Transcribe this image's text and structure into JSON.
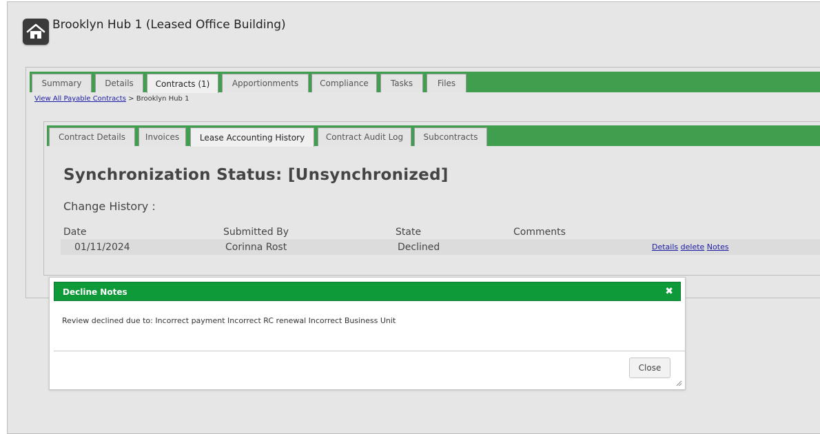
{
  "page": {
    "title": "Brooklyn Hub 1 (Leased Office Building)",
    "home_icon": "home-icon"
  },
  "main_tabs": [
    {
      "label": "Summary"
    },
    {
      "label": "Details"
    },
    {
      "label": "Contracts (1)",
      "active": true
    },
    {
      "label": "Apportionments"
    },
    {
      "label": "Compliance"
    },
    {
      "label": "Tasks"
    },
    {
      "label": "Files"
    }
  ],
  "breadcrumb": {
    "link": "View All Payable Contracts",
    "separator": ">",
    "current": "Brooklyn Hub 1"
  },
  "sub_tabs": [
    {
      "label": "Contract Details"
    },
    {
      "label": "Invoices"
    },
    {
      "label": "Lease Accounting History",
      "active": true
    },
    {
      "label": "Contract Audit Log"
    },
    {
      "label": "Subcontracts"
    }
  ],
  "content": {
    "sync_status": "Synchronization Status: [Unsynchronized]",
    "change_history": "Change History :",
    "columns": [
      "Date",
      "Submitted By",
      "State",
      "Comments"
    ],
    "rows": [
      {
        "date": "01/11/2024",
        "submitted_by": "Corinna Rost",
        "state": "Declined",
        "comments": "",
        "actions": [
          "Details",
          "delete",
          "Notes"
        ]
      }
    ]
  },
  "dialog": {
    "title": "Decline Notes",
    "close_icon": "close-icon",
    "text": "Review declined due to: Incorrect payment Incorrect RC renewal Incorrect Business Unit",
    "close_button": "Close"
  },
  "colors": {
    "tabbar_green": "#3f9f4f",
    "dialog_green": "#0f9a3a",
    "link_blue": "#1a1aa6"
  }
}
